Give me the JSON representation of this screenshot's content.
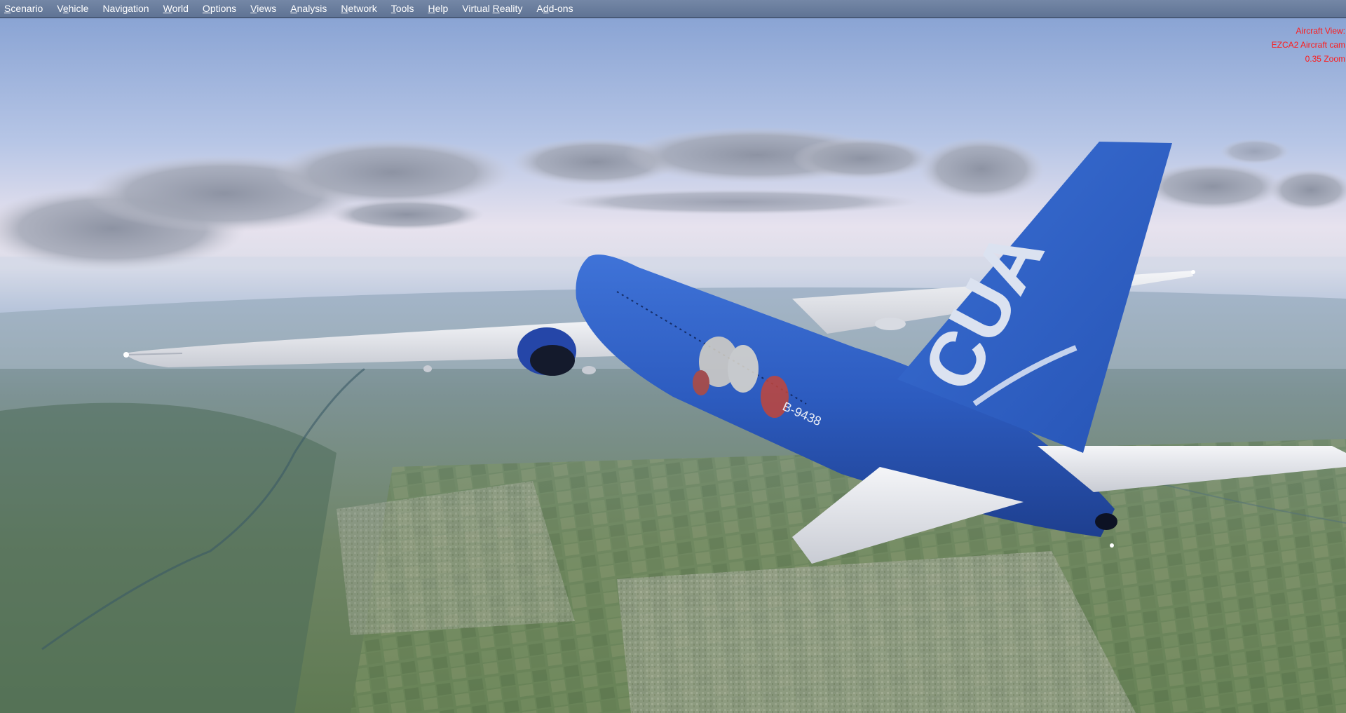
{
  "menubar": {
    "items": [
      {
        "pre": "",
        "acc": "S",
        "post": "cenario"
      },
      {
        "pre": "V",
        "acc": "e",
        "post": "hicle"
      },
      {
        "pre": "",
        "acc": "",
        "post": "Navigation"
      },
      {
        "pre": "",
        "acc": "W",
        "post": "orld"
      },
      {
        "pre": "",
        "acc": "O",
        "post": "ptions"
      },
      {
        "pre": "",
        "acc": "V",
        "post": "iews"
      },
      {
        "pre": "",
        "acc": "A",
        "post": "nalysis"
      },
      {
        "pre": "",
        "acc": "N",
        "post": "etwork"
      },
      {
        "pre": "",
        "acc": "T",
        "post": "ools"
      },
      {
        "pre": "",
        "acc": "H",
        "post": "elp"
      },
      {
        "pre": "Virtual ",
        "acc": "R",
        "post": "eality"
      },
      {
        "pre": "A",
        "acc": "d",
        "post": "d-ons"
      }
    ]
  },
  "camera_overlay": {
    "line1": "Aircraft View:",
    "line2": "EZCA2 Aircraft cam",
    "line3": "0.35 Zoom",
    "color": "#ff1a1a"
  },
  "aircraft": {
    "tail_logo": "CUA",
    "registration": "B-9438",
    "livery_color": "#2f5fc4"
  },
  "colors": {
    "menubar": "#6a7d9d",
    "sky_top": "#8fa8d6",
    "sky_horizon": "#e9e6ef",
    "ground": "#6d8a6a"
  }
}
